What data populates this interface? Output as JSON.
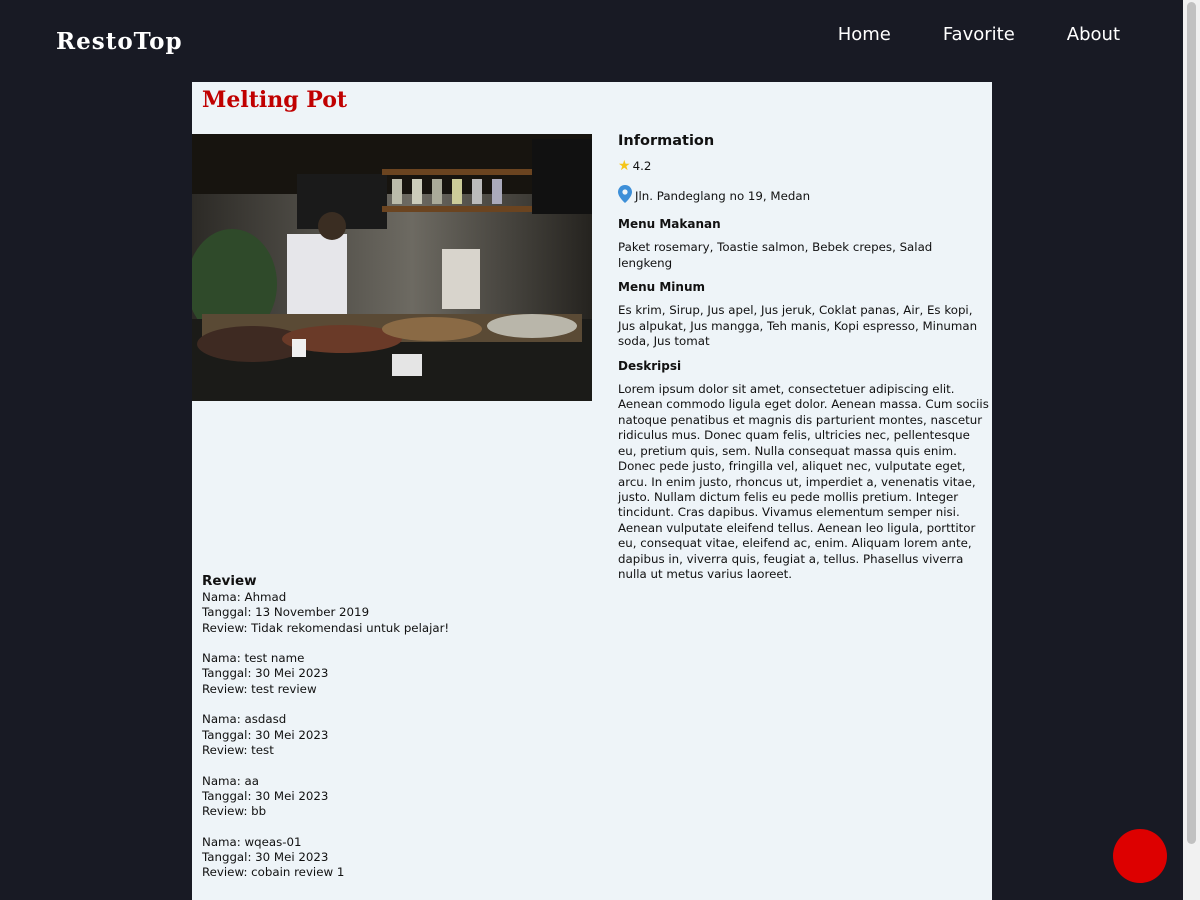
{
  "header": {
    "brand": "RestoTop",
    "nav": [
      {
        "label": "Home"
      },
      {
        "label": "Favorite"
      },
      {
        "label": "About"
      }
    ]
  },
  "restaurant": {
    "name": "Melting Pot",
    "info_heading": "Information",
    "rating": "4.2",
    "address": "Jln. Pandeglang no 19, Medan",
    "food_heading": "Menu Makanan",
    "foods": "Paket rosemary, Toastie salmon, Bebek crepes, Salad lengkeng",
    "drink_heading": "Menu Minum",
    "drinks": "Es krim, Sirup, Jus apel, Jus jeruk, Coklat panas, Air, Es kopi, Jus alpukat, Jus mangga, Teh manis, Kopi espresso, Minuman soda, Jus tomat",
    "desc_heading": "Deskripsi",
    "description": "Lorem ipsum dolor sit amet, consectetuer adipiscing elit. Aenean commodo ligula eget dolor. Aenean massa. Cum sociis natoque penatibus et magnis dis parturient montes, nascetur ridiculus mus. Donec quam felis, ultricies nec, pellentesque eu, pretium quis, sem. Nulla consequat massa quis enim. Donec pede justo, fringilla vel, aliquet nec, vulputate eget, arcu. In enim justo, rhoncus ut, imperdiet a, venenatis vitae, justo. Nullam dictum felis eu pede mollis pretium. Integer tincidunt. Cras dapibus. Vivamus elementum semper nisi. Aenean vulputate eleifend tellus. Aenean leo ligula, porttitor eu, consequat vitae, eleifend ac, enim. Aliquam lorem ante, dapibus in, viverra quis, feugiat a, tellus. Phasellus viverra nulla ut metus varius laoreet."
  },
  "reviews": {
    "heading": "Review",
    "items": [
      {
        "name": "Nama: Ahmad",
        "date": "Tanggal: 13 November 2019",
        "text": "Review: Tidak rekomendasi untuk pelajar!"
      },
      {
        "name": "Nama: test name",
        "date": "Tanggal: 30 Mei 2023",
        "text": "Review: test review"
      },
      {
        "name": "Nama: asdasd",
        "date": "Tanggal: 30 Mei 2023",
        "text": "Review: test"
      },
      {
        "name": "Nama: aa",
        "date": "Tanggal: 30 Mei 2023",
        "text": "Review: bb"
      },
      {
        "name": "Nama: wqeas-01",
        "date": "Tanggal: 30 Mei 2023",
        "text": "Review: cobain review 1"
      }
    ]
  },
  "icons": {
    "rating": "star-icon",
    "address": "map-pin-icon",
    "favorite_button": "favorite-button"
  },
  "colors": {
    "background": "#181a24",
    "panel": "#eef4f8",
    "title": "#c00000",
    "fab": "#dd0000"
  }
}
